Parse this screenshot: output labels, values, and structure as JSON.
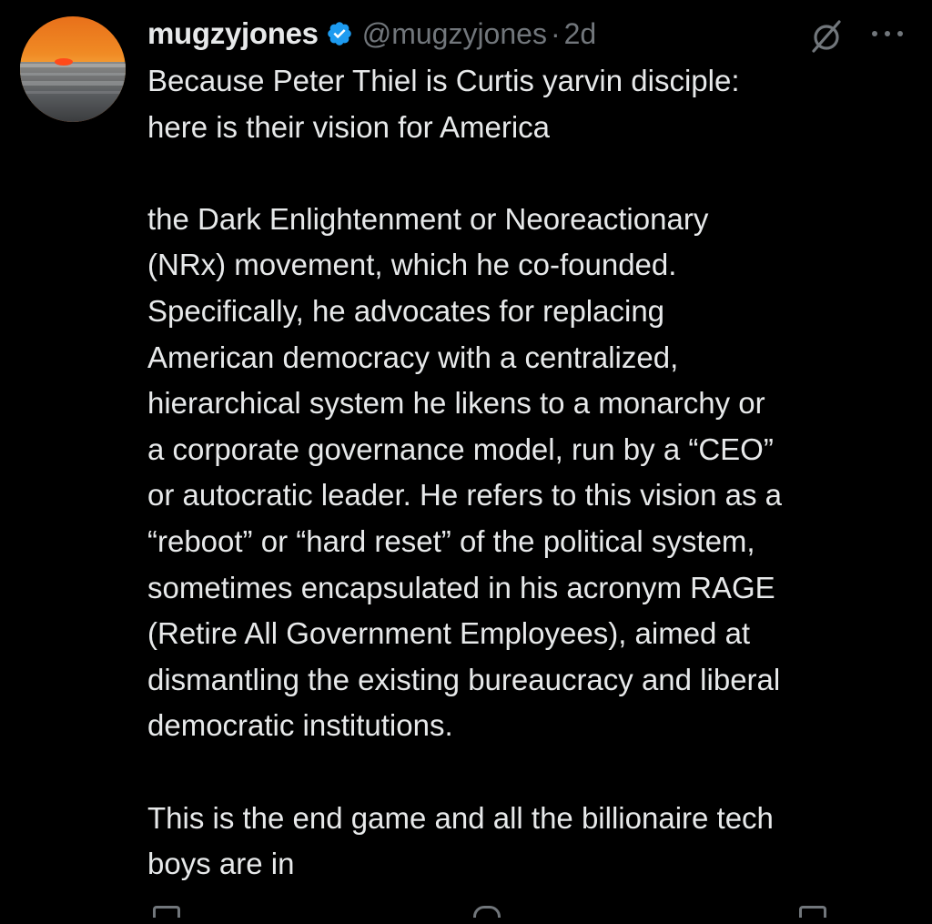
{
  "post": {
    "author": {
      "display_name": "mugzyjones",
      "handle": "@mugzyjones",
      "verified": true,
      "avatar_icon": "sunset-avatar"
    },
    "separator": "·",
    "timestamp": "2d",
    "header_icons": [
      "grok-icon",
      "more-icon"
    ],
    "paragraphs": [
      [
        "Because Peter Thiel is Curtis  yarvin disciple:",
        "here is their vision for America"
      ],
      [
        "the Dark Enlightenment or Neoreactionary",
        "(NRx) movement, which he co-founded.",
        "Specifically, he advocates for replacing",
        "American democracy with a centralized,",
        "hierarchical system he likens to a monarchy or",
        "a corporate governance model, run by a “CEO”",
        "or autocratic leader. He refers to this vision as a",
        "“reboot” or “hard reset” of the political system,",
        "sometimes encapsulated in his acronym RAGE",
        "(Retire All Government Employees), aimed at",
        "dismantling the existing bureaucracy and liberal",
        "democratic institutions."
      ],
      [
        "This is the end game and all the billionaire tech",
        "boys are in"
      ]
    ]
  },
  "colors": {
    "background": "#000000",
    "text_primary": "#e7e9ea",
    "text_secondary": "#71767b",
    "verified_blue": "#1d9bf0"
  }
}
